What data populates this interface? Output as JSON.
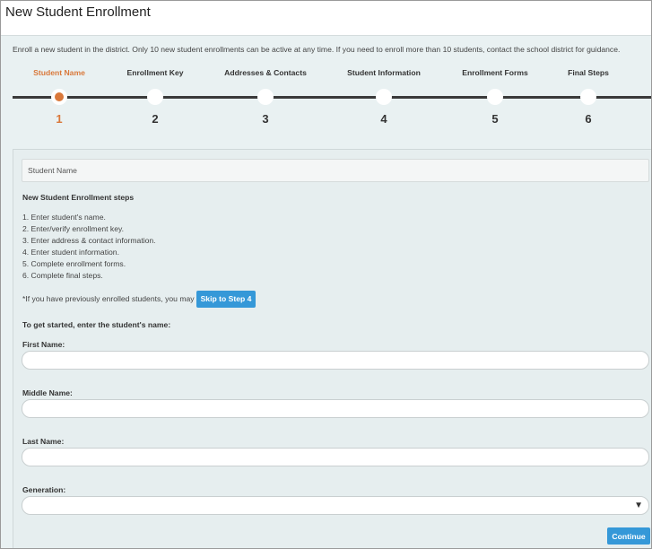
{
  "window": {
    "title": "New Student Enrollment"
  },
  "intro_text": "Enroll a new student in the district. Only 10 new student enrollments can be active at any time. If you need to enroll more than 10 students, contact the school district for guidance.",
  "steps": [
    {
      "label": "Student Name",
      "number": "1",
      "active": true
    },
    {
      "label": "Enrollment Key",
      "number": "2",
      "active": false
    },
    {
      "label": "Addresses & Contacts",
      "number": "3",
      "active": false
    },
    {
      "label": "Student Information",
      "number": "4",
      "active": false
    },
    {
      "label": "Enrollment Forms",
      "number": "5",
      "active": false
    },
    {
      "label": "Final Steps",
      "number": "6",
      "active": false
    }
  ],
  "panel": {
    "header": "Student Name",
    "steps_title": "New Student Enrollment steps",
    "steps_list": [
      "1. Enter student's name.",
      "2. Enter/verify enrollment key.",
      "3. Enter address & contact information.",
      "4. Enter student information.",
      "5. Complete enrollment forms.",
      "6. Complete final steps."
    ],
    "skip_text": "*If you have previously enrolled students, you may",
    "skip_button": "Skip to Step 4",
    "get_started": "To get started, enter the student's name:",
    "fields": {
      "first_name": {
        "label": "First Name:",
        "value": ""
      },
      "middle_name": {
        "label": "Middle Name:",
        "value": ""
      },
      "last_name": {
        "label": "Last Name:",
        "value": ""
      },
      "generation": {
        "label": "Generation:",
        "selected": ""
      }
    },
    "continue_button": "Continue"
  },
  "colors": {
    "accent": "#3598d8",
    "active_step": "#d9783a",
    "background": "#e9f1f2"
  },
  "icons": {
    "select_arrow": "chevron-down-icon"
  }
}
